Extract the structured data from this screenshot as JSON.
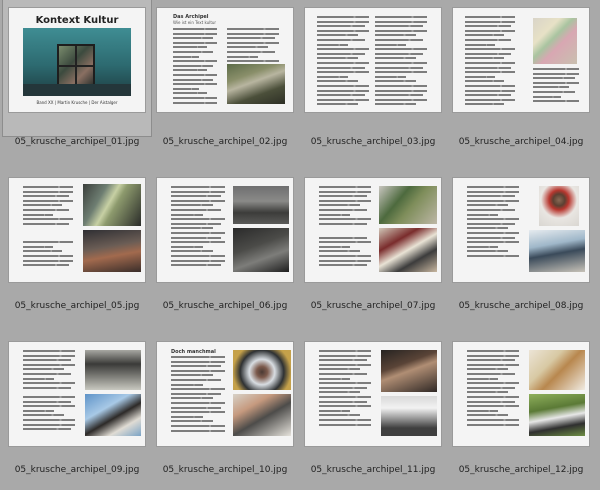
{
  "thumbnails": [
    {
      "filename": "05_krusche_archipel_01.jpg",
      "selected": true
    },
    {
      "filename": "05_krusche_archipel_02.jpg"
    },
    {
      "filename": "05_krusche_archipel_03.jpg"
    },
    {
      "filename": "05_krusche_archipel_04.jpg"
    },
    {
      "filename": "05_krusche_archipel_05.jpg"
    },
    {
      "filename": "05_krusche_archipel_06.jpg"
    },
    {
      "filename": "05_krusche_archipel_07.jpg"
    },
    {
      "filename": "05_krusche_archipel_08.jpg"
    },
    {
      "filename": "05_krusche_archipel_09.jpg"
    },
    {
      "filename": "05_krusche_archipel_10.jpg"
    },
    {
      "filename": "05_krusche_archipel_11.jpg"
    },
    {
      "filename": "05_krusche_archipel_12.jpg"
    }
  ],
  "cover": {
    "title": "Kontext Kultur",
    "subtitle": "Band XX | Martin Krusche | Der Aistalger"
  },
  "page02": {
    "heading": "Das Archipel",
    "subheading": "Wie ist ein Text kultur"
  },
  "page10": {
    "heading": "Doch manchmal"
  }
}
